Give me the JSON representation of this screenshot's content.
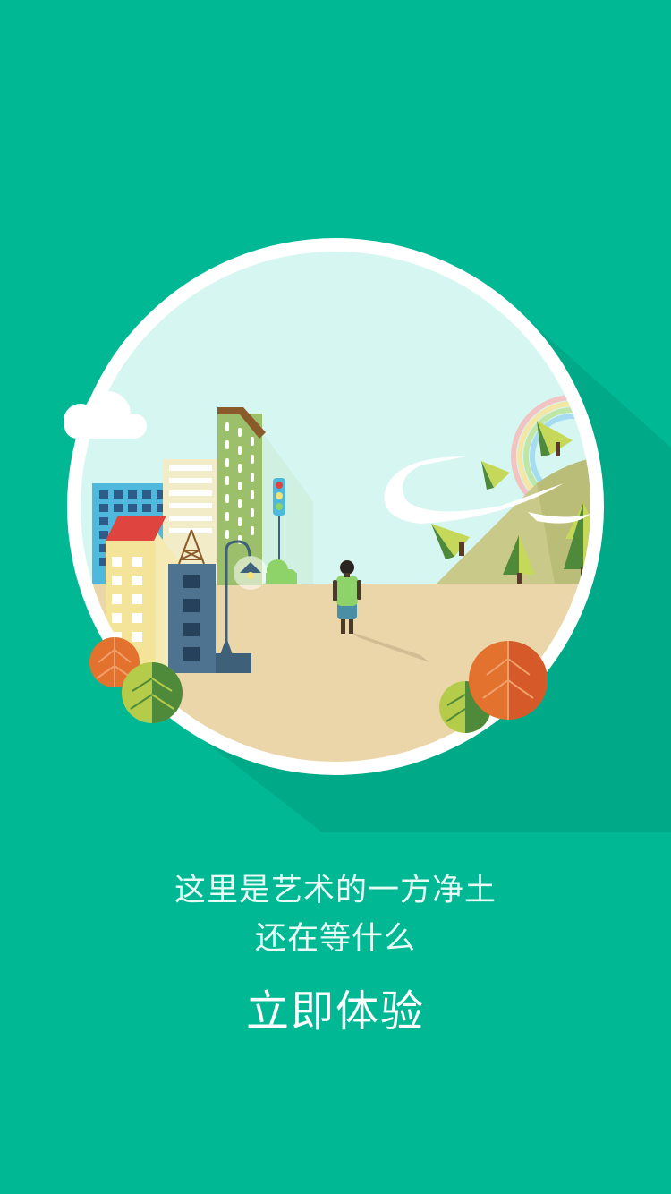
{
  "welcome": {
    "line1": "这里是艺术的一方净土",
    "line2": "还在等什么",
    "cta_label": "立即体验"
  },
  "colors": {
    "background": "#00b894",
    "frame": "#ffffff",
    "sky": "#d6f7f1",
    "ground": "#ead6a8",
    "text": "#e9fbf5"
  }
}
